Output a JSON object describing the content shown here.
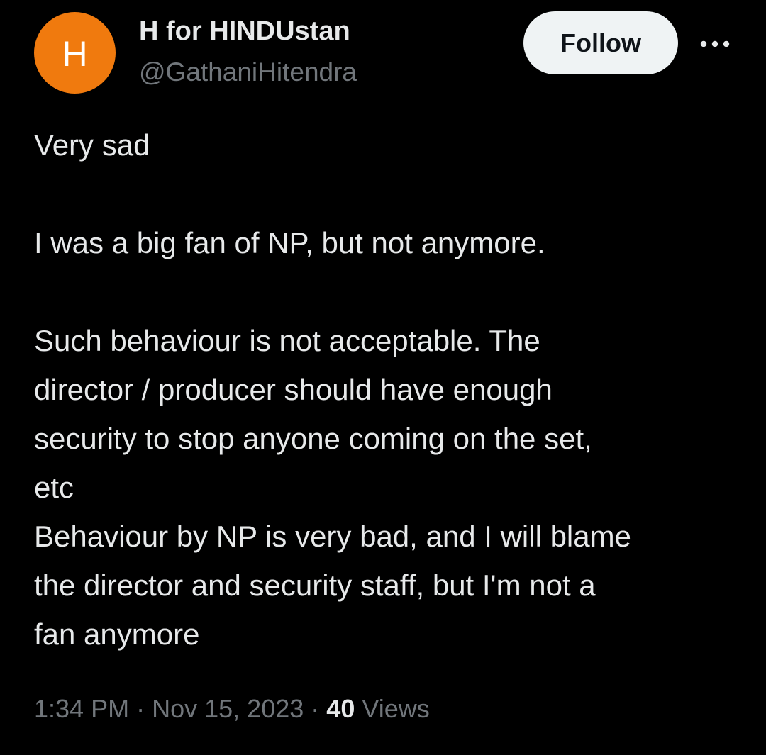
{
  "author": {
    "avatar_letter": "H",
    "avatar_color": "#f07a0e",
    "display_name": "H for HINDUstan",
    "handle": "@GathaniHitendra"
  },
  "actions": {
    "follow_label": "Follow",
    "more_icon": "more-horizontal-icon"
  },
  "tweet": {
    "paragraphs": [
      "Very sad",
      "I was a big fan of NP, but not anymore.",
      "Such behaviour is not acceptable. The\ndirector / producer should have enough\nsecurity to stop anyone coming on the set,\netc\nBehaviour by NP is very bad, and I will blame\nthe director and security staff, but I'm not a\nfan anymore"
    ]
  },
  "meta": {
    "time": "1:34 PM",
    "separator": "·",
    "date": "Nov 15, 2023",
    "views_count": "40",
    "views_label": "Views"
  },
  "colors": {
    "background": "#000000",
    "text_primary": "#e7e9ea",
    "text_secondary": "#71767b",
    "follow_bg": "#eff3f4"
  }
}
